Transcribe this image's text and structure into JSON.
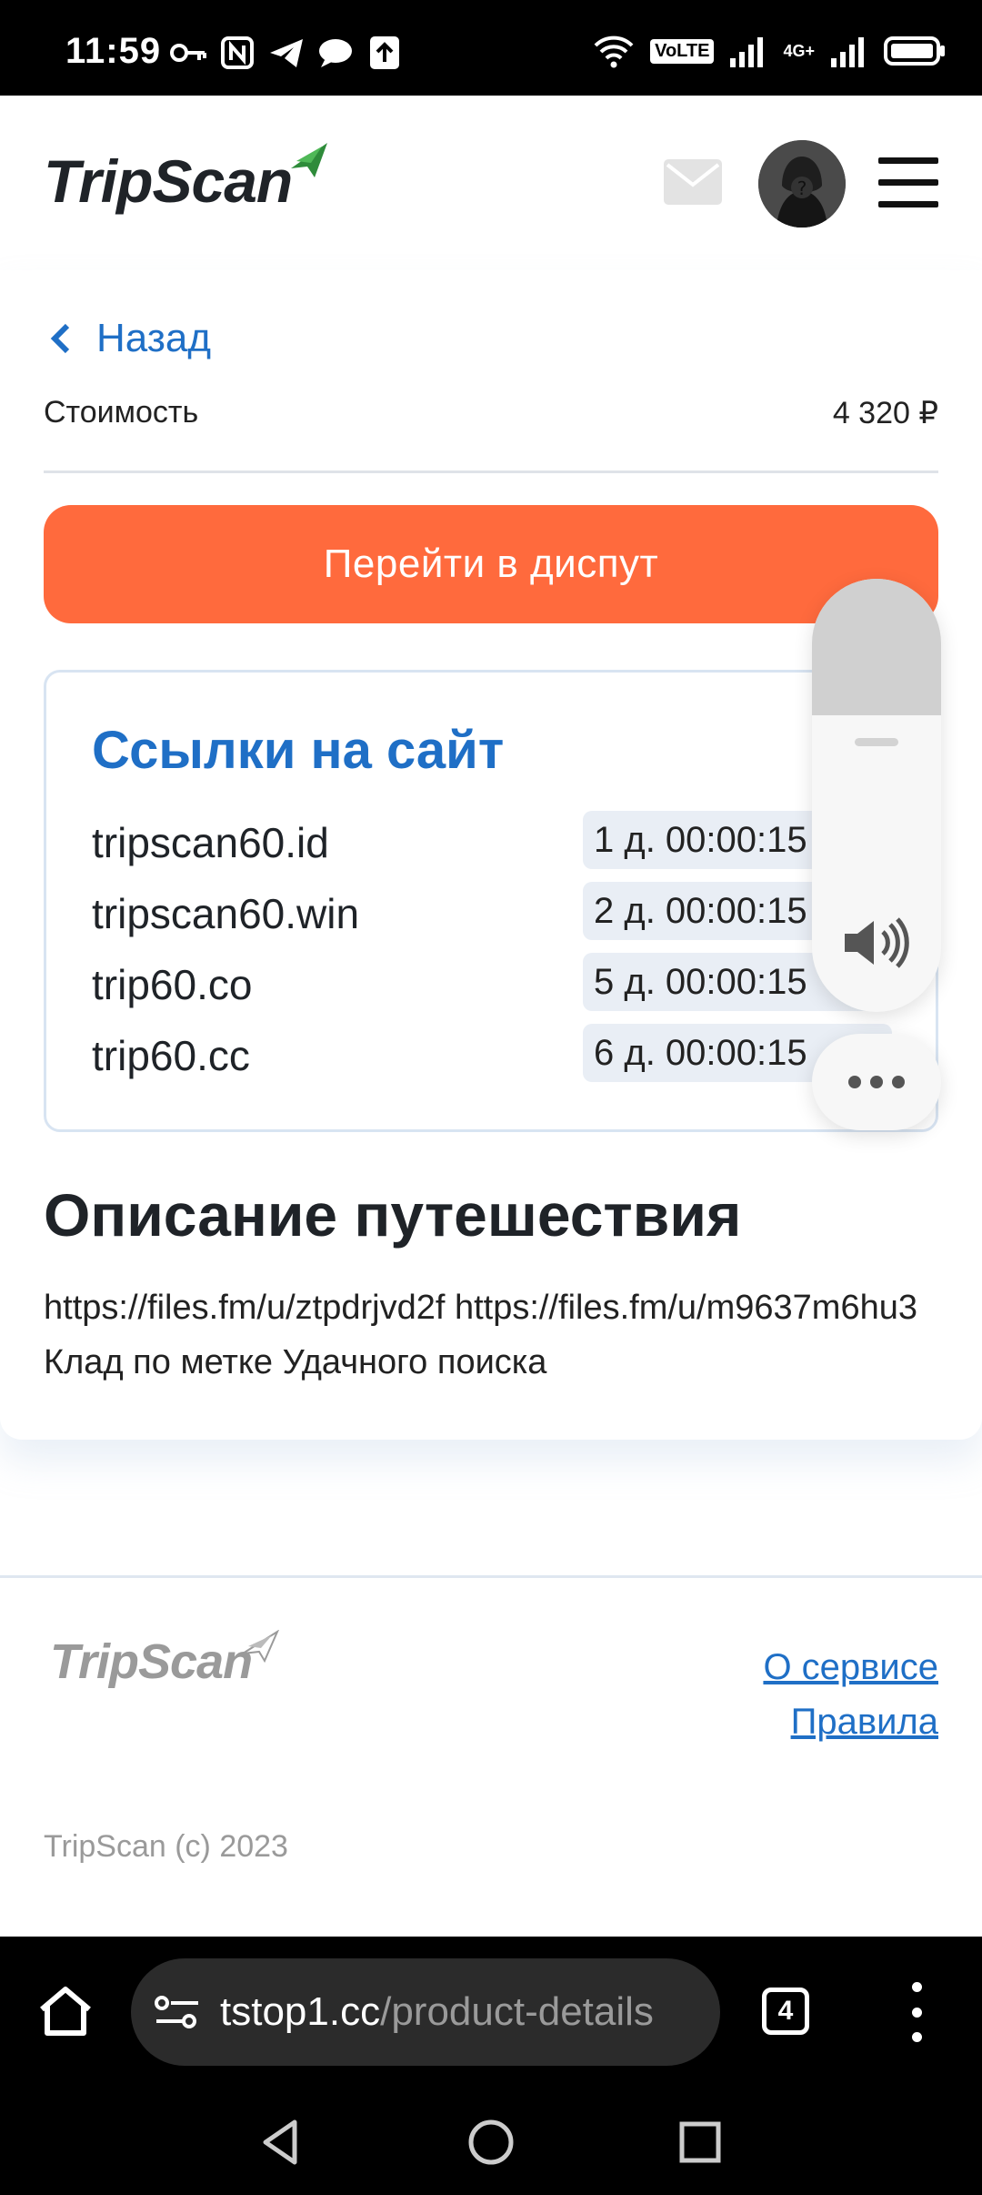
{
  "status_bar": {
    "time": "11:59",
    "network_label": "VoLTE",
    "signal_label": "4G+"
  },
  "header": {
    "logo_text": "TripScan",
    "icons": [
      "mail-icon",
      "avatar",
      "menu-icon"
    ]
  },
  "page": {
    "back_label": "Назад",
    "cost_label": "Стоимость",
    "cost_value": "4 320 ₽",
    "dispute_button": "Перейти в диспут",
    "links_section": {
      "title": "Ссылки на сайт",
      "links": [
        {
          "domain": "tripscan60.id",
          "time": "1 д. 00:00:15"
        },
        {
          "domain": "tripscan60.win",
          "time": "2 д. 00:00:15"
        },
        {
          "domain": "trip60.co",
          "time": "5 д. 00:00:15"
        },
        {
          "domain": "trip60.cc",
          "time": "6 д. 00:00:15"
        }
      ]
    },
    "description_title": "Описание путешествия",
    "description_text": "https://files.fm/u/ztpdrjvd2f https://files.fm/u/m9637m6hu3 Клад по метке Удачного поиска"
  },
  "volume_overlay": {
    "level": 0.3
  },
  "footer": {
    "logo_text": "TripScan",
    "links": [
      "О сервисе",
      "Правила"
    ],
    "copyright": "TripScan (c) 2023"
  },
  "browser": {
    "url_host": "tstop1.cc",
    "url_path": "/product-details",
    "tab_count": "4"
  },
  "colors": {
    "accent": "#1f6fc6",
    "dispute_button": "#ff6a3d"
  }
}
